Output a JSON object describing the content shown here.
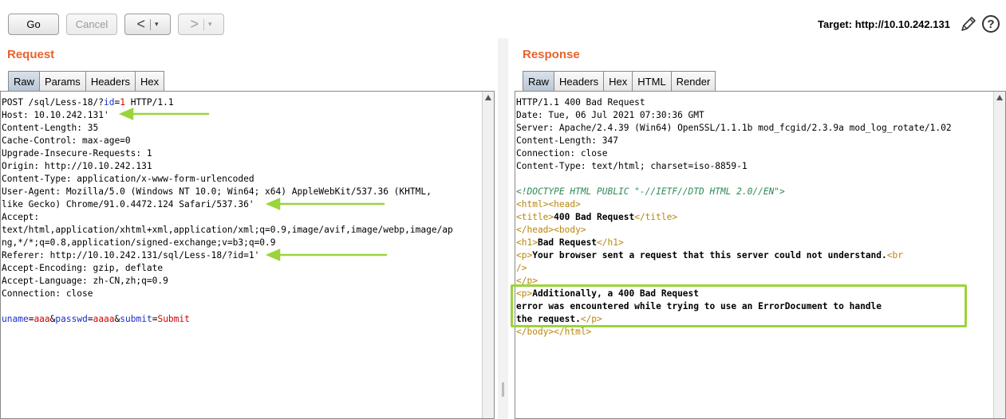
{
  "toolbar": {
    "go_label": "Go",
    "cancel_label": "Cancel",
    "back_label": "<",
    "forward_label": ">",
    "dropdown_glyph": "▾",
    "target_label": "Target: http://10.10.242.131",
    "help_glyph": "?"
  },
  "request": {
    "title": "Request",
    "tabs": [
      "Raw",
      "Params",
      "Headers",
      "Hex"
    ],
    "active_tab": "Raw",
    "line1": {
      "a": "POST /sql/Less-18/?",
      "b": "id",
      "c": "=",
      "d": "1",
      "e": " HTTP/1.1"
    },
    "lines": [
      "Host: 10.10.242.131'",
      "Content-Length: 35",
      "Cache-Control: max-age=0",
      "Upgrade-Insecure-Requests: 1",
      "Origin: http://10.10.242.131",
      "Content-Type: application/x-www-form-urlencoded",
      "User-Agent: Mozilla/5.0 (Windows NT 10.0; Win64; x64) AppleWebKit/537.36 (KHTML,",
      "like Gecko) Chrome/91.0.4472.124 Safari/537.36'",
      "Accept:",
      "text/html,application/xhtml+xml,application/xml;q=0.9,image/avif,image/webp,image/ap",
      "ng,*/*;q=0.8,application/signed-exchange;v=b3;q=0.9",
      "Referer: http://10.10.242.131/sql/Less-18/?id=1'",
      "Accept-Encoding: gzip, deflate",
      "Accept-Language: zh-CN,zh;q=0.9",
      "Connection: close"
    ],
    "body": {
      "k1": "uname",
      "v1": "aaa",
      "k2": "passwd",
      "v2": "aaaa",
      "k3": "submit",
      "v3": "Submit",
      "eq": "=",
      "amp": "&"
    }
  },
  "response": {
    "title": "Response",
    "tabs": [
      "Raw",
      "Headers",
      "Hex",
      "HTML",
      "Render"
    ],
    "active_tab": "Raw",
    "headers": [
      "HTTP/1.1 400 Bad Request",
      "Date: Tue, 06 Jul 2021 07:30:36 GMT",
      "Server: Apache/2.4.39 (Win64) OpenSSL/1.1.1b mod_fcgid/2.3.9a mod_log_rotate/1.02",
      "Content-Length: 347",
      "Connection: close",
      "Content-Type: text/html; charset=iso-8859-1"
    ],
    "html": {
      "doctype": "<!DOCTYPE HTML PUBLIC \"-//IETF//DTD HTML 2.0//EN\">",
      "html_head": "<html><head>",
      "title_open": "<title>",
      "title_text": "400 Bad Request",
      "title_close": "</title>",
      "head_close_body": "</head><body>",
      "h1_open": "<h1>",
      "h1_text": "Bad Request",
      "h1_close": "</h1>",
      "p_open": "<p>",
      "p1_text": "Your browser sent a request that this server could not understand.",
      "br_start": "<br",
      "br_end": "/>",
      "p_close": "</p>",
      "p2_line1": "Additionally, a 400 Bad Request",
      "p2_line2": "error was encountered while trying to use an ErrorDocument to handle",
      "p2_line3": "the request.",
      "body_html_close": "</body></html>"
    }
  },
  "colors": {
    "title_orange": "#e8632b",
    "highlight_green": "#9bd43a",
    "param_key": "#1a2ecb",
    "param_value": "#d40000"
  }
}
